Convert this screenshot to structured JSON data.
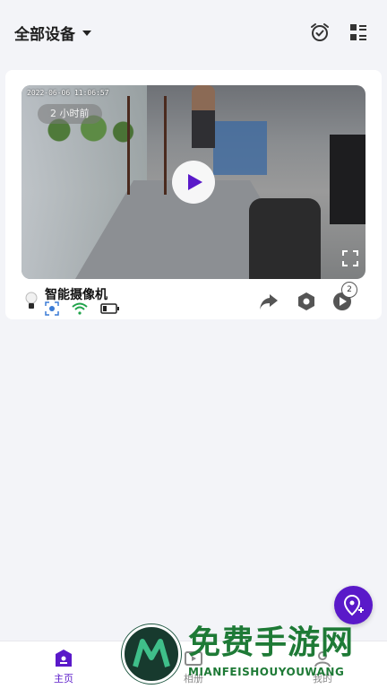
{
  "header": {
    "device_filter_label": "全部设备",
    "icons": [
      "alarm-clock-icon",
      "layout-grid-icon"
    ]
  },
  "camera_card": {
    "timestamp": "2022-06-06 11:06:57",
    "last_seen_badge": "2 小时前",
    "name": "智能摄像机",
    "playback_count": "2",
    "status_icons": [
      "face-detect-icon",
      "wifi-icon",
      "battery-icon"
    ],
    "actions": [
      "share-icon",
      "settings-icon",
      "playback-icon"
    ]
  },
  "colors": {
    "accent": "#5a19c9",
    "background": "#f3f4f8",
    "wifi": "#1fa34a"
  },
  "tabbar": {
    "tabs": [
      {
        "label": "主页",
        "icon": "home-icon",
        "active": true
      },
      {
        "label": "相册",
        "icon": "album-icon",
        "active": false
      },
      {
        "label": "我的",
        "icon": "profile-icon",
        "active": false
      }
    ]
  },
  "watermark": {
    "title": "免费手游网",
    "subtitle": "MIANFEISHOUYOUWANG"
  }
}
